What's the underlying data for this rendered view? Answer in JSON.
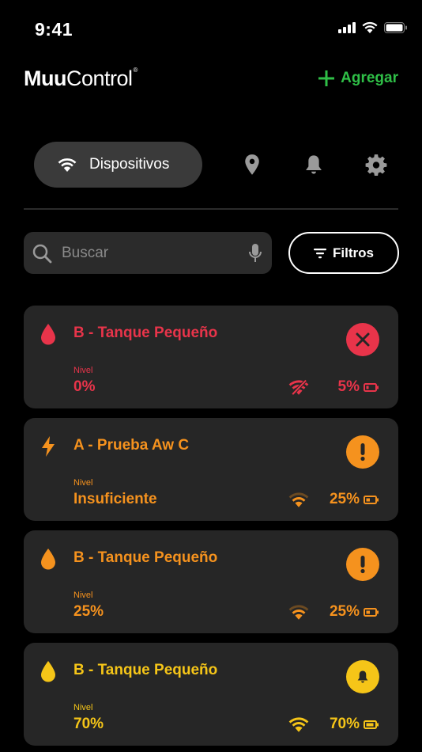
{
  "status_bar": {
    "time": "9:41"
  },
  "header": {
    "logo_bold": "Muu",
    "logo_light": "Control",
    "logo_mark": "®",
    "add_label": "Agregar"
  },
  "nav": {
    "active_tab": "Dispositivos"
  },
  "search": {
    "placeholder": "Buscar",
    "filter_label": "Filtros"
  },
  "colors": {
    "green": "#2fbf47",
    "red": "#e8344a",
    "orange": "#f5921e",
    "yellow": "#f5c518",
    "card_bg": "#262626"
  },
  "devices": [
    {
      "title": "B - Tanque Pequeño",
      "type_icon": "drop-icon",
      "status_icon": "close-icon",
      "level_label": "Nivel",
      "level": "0%",
      "wifi": "wifi-off-icon",
      "battery": "5%"
    },
    {
      "title": "A - Prueba Aw C",
      "type_icon": "bolt-icon",
      "status_icon": "warning-icon",
      "level_label": "Nivel",
      "level": "Insuficiente",
      "wifi": "wifi-icon",
      "battery": "25%"
    },
    {
      "title": "B - Tanque Pequeño",
      "type_icon": "drop-icon",
      "status_icon": "warning-icon",
      "level_label": "Nivel",
      "level": "25%",
      "wifi": "wifi-icon",
      "battery": "25%"
    },
    {
      "title": "B - Tanque Pequeño",
      "type_icon": "drop-icon",
      "status_icon": "bell-icon",
      "level_label": "Nivel",
      "level": "70%",
      "wifi": "wifi-icon",
      "battery": "70%"
    }
  ]
}
